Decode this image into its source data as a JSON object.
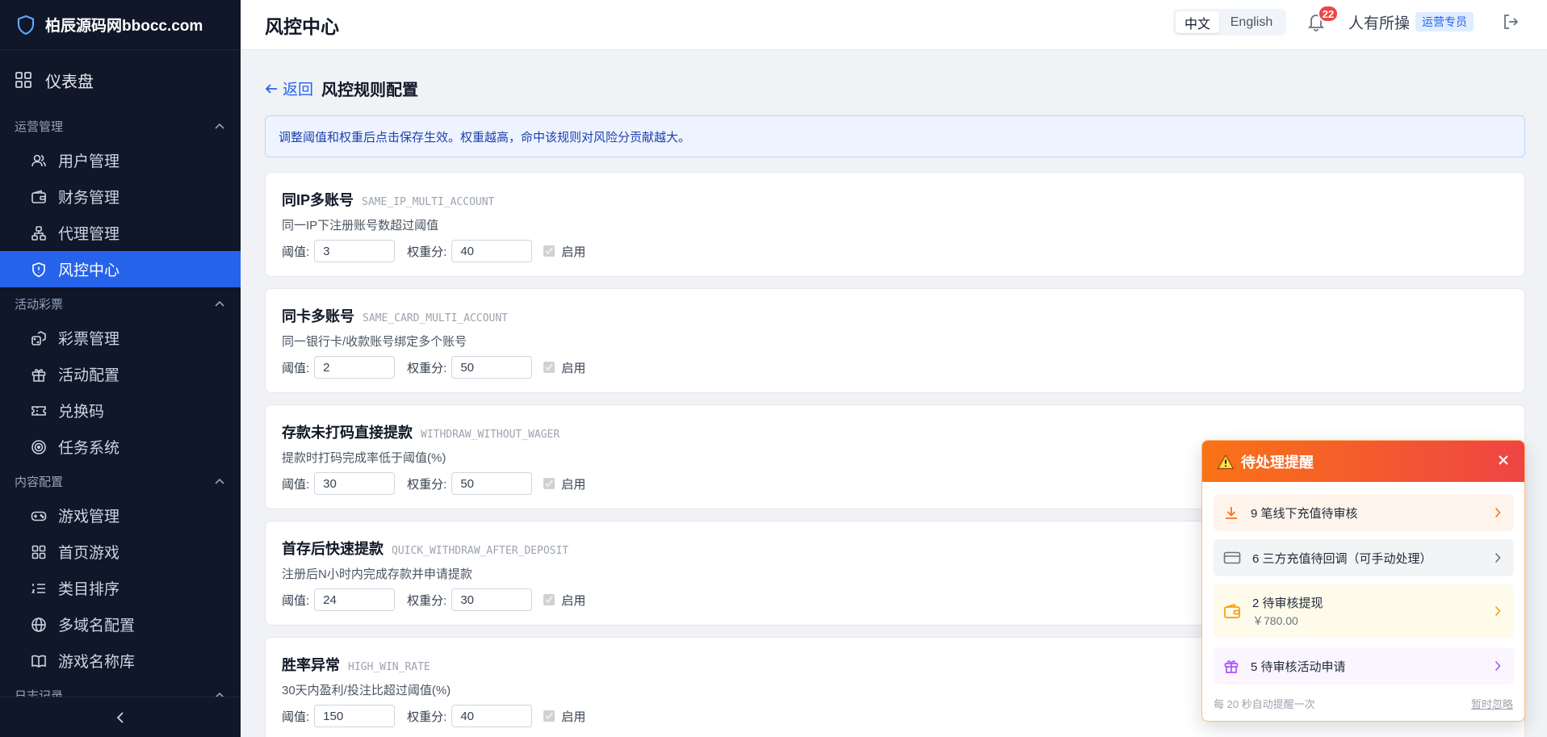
{
  "brand": {
    "name": "柏辰源码网bbocc.com"
  },
  "sidebar": {
    "dashboard": "仪表盘",
    "groups": [
      {
        "label": "运营管理",
        "items": [
          "用户管理",
          "财务管理",
          "代理管理",
          "风控中心"
        ]
      },
      {
        "label": "活动彩票",
        "items": [
          "彩票管理",
          "活动配置",
          "兑换码",
          "任务系统"
        ]
      },
      {
        "label": "内容配置",
        "items": [
          "游戏管理",
          "首页游戏",
          "类目排序",
          "多域名配置",
          "游戏名称库"
        ]
      },
      {
        "label": "日志记录",
        "items": []
      }
    ],
    "active_item": "风控中心"
  },
  "header": {
    "title": "风控中心",
    "lang_zh": "中文",
    "lang_en": "English",
    "notification_count": "22",
    "user": "人有所操",
    "role": "运营专员"
  },
  "main": {
    "back": "返回",
    "page_title": "风控规则配置",
    "notice": "调整阈值和权重后点击保存生效。权重越高，命中该规则对风险分贡献越大。",
    "threshold_label": "阈值:",
    "weight_label": "权重分:",
    "enabled_label": "启用",
    "rules": [
      {
        "name": "同IP多账号",
        "code": "SAME_IP_MULTI_ACCOUNT",
        "desc": "同一IP下注册账号数超过阈值",
        "threshold": "3",
        "weight": "40"
      },
      {
        "name": "同卡多账号",
        "code": "SAME_CARD_MULTI_ACCOUNT",
        "desc": "同一银行卡/收款账号绑定多个账号",
        "threshold": "2",
        "weight": "50"
      },
      {
        "name": "存款未打码直接提款",
        "code": "WITHDRAW_WITHOUT_WAGER",
        "desc": "提款时打码完成率低于阈值(%)",
        "threshold": "30",
        "weight": "50"
      },
      {
        "name": "首存后快速提款",
        "code": "QUICK_WITHDRAW_AFTER_DEPOSIT",
        "desc": "注册后N小时内完成存款并申请提款",
        "threshold": "24",
        "weight": "30"
      },
      {
        "name": "胜率异常",
        "code": "HIGH_WIN_RATE",
        "desc": "30天内盈利/投注比超过阈值(%)",
        "threshold": "150",
        "weight": "40"
      }
    ]
  },
  "popup": {
    "title": "待处理提醒",
    "items": [
      {
        "text": "9 笔线下充值待审核",
        "sub": "",
        "bg": "#fff4ec",
        "icon_color": "#f97316"
      },
      {
        "text": "6 三方充值待回调（可手动处理）",
        "sub": "",
        "bg": "#f3f4f6",
        "icon_color": "#6b7280"
      },
      {
        "text": "2 待审核提现",
        "sub": "￥780.00",
        "bg": "#fffbeb",
        "icon_color": "#f59e0b"
      },
      {
        "text": "5 待审核活动申请",
        "sub": "",
        "bg": "#faf5ff",
        "icon_color": "#a855f7"
      }
    ],
    "footer": "每 20 秒自动提醒一次",
    "ignore": "暂时忽略"
  }
}
